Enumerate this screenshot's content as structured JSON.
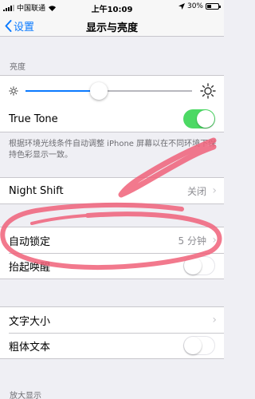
{
  "status_bar": {
    "carrier": "中国联通",
    "time": "上午10:09",
    "battery_percent": "30%",
    "battery_level": 0.3
  },
  "nav": {
    "back_label": "设置",
    "title": "显示与亮度"
  },
  "brightness": {
    "section_header": "亮度",
    "level": 0.44,
    "low_icon": "sun-small-icon",
    "high_icon": "sun-large-icon"
  },
  "true_tone": {
    "label": "True Tone",
    "on": true,
    "footer": "根据环境光线条件自动调整 iPhone 屏幕以在不同环境下保持色彩显示一致。"
  },
  "night_shift": {
    "label": "Night Shift",
    "value": "关闭"
  },
  "auto_lock": {
    "label": "自动锁定",
    "value": "5 分钟"
  },
  "raise_to_wake": {
    "label": "抬起唤醒",
    "on": false
  },
  "text_size": {
    "label": "文字大小"
  },
  "bold_text": {
    "label": "粗体文本",
    "on": false
  },
  "zoom": {
    "section_header": "放大显示"
  },
  "colors": {
    "accent": "#0a7aff",
    "toggle_on": "#4cd964",
    "annotation": "#f0627a"
  }
}
